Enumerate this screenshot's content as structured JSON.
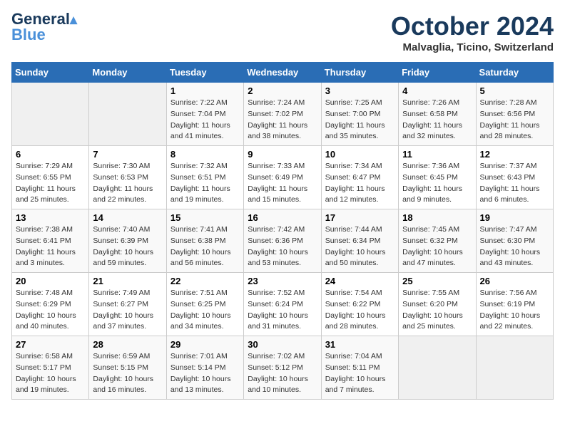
{
  "header": {
    "logo_line1": "General",
    "logo_line2": "Blue",
    "month": "October 2024",
    "location": "Malvaglia, Ticino, Switzerland"
  },
  "days_of_week": [
    "Sunday",
    "Monday",
    "Tuesday",
    "Wednesday",
    "Thursday",
    "Friday",
    "Saturday"
  ],
  "weeks": [
    [
      {
        "day": "",
        "sunrise": "",
        "sunset": "",
        "daylight": ""
      },
      {
        "day": "",
        "sunrise": "",
        "sunset": "",
        "daylight": ""
      },
      {
        "day": "1",
        "sunrise": "Sunrise: 7:22 AM",
        "sunset": "Sunset: 7:04 PM",
        "daylight": "Daylight: 11 hours and 41 minutes."
      },
      {
        "day": "2",
        "sunrise": "Sunrise: 7:24 AM",
        "sunset": "Sunset: 7:02 PM",
        "daylight": "Daylight: 11 hours and 38 minutes."
      },
      {
        "day": "3",
        "sunrise": "Sunrise: 7:25 AM",
        "sunset": "Sunset: 7:00 PM",
        "daylight": "Daylight: 11 hours and 35 minutes."
      },
      {
        "day": "4",
        "sunrise": "Sunrise: 7:26 AM",
        "sunset": "Sunset: 6:58 PM",
        "daylight": "Daylight: 11 hours and 32 minutes."
      },
      {
        "day": "5",
        "sunrise": "Sunrise: 7:28 AM",
        "sunset": "Sunset: 6:56 PM",
        "daylight": "Daylight: 11 hours and 28 minutes."
      }
    ],
    [
      {
        "day": "6",
        "sunrise": "Sunrise: 7:29 AM",
        "sunset": "Sunset: 6:55 PM",
        "daylight": "Daylight: 11 hours and 25 minutes."
      },
      {
        "day": "7",
        "sunrise": "Sunrise: 7:30 AM",
        "sunset": "Sunset: 6:53 PM",
        "daylight": "Daylight: 11 hours and 22 minutes."
      },
      {
        "day": "8",
        "sunrise": "Sunrise: 7:32 AM",
        "sunset": "Sunset: 6:51 PM",
        "daylight": "Daylight: 11 hours and 19 minutes."
      },
      {
        "day": "9",
        "sunrise": "Sunrise: 7:33 AM",
        "sunset": "Sunset: 6:49 PM",
        "daylight": "Daylight: 11 hours and 15 minutes."
      },
      {
        "day": "10",
        "sunrise": "Sunrise: 7:34 AM",
        "sunset": "Sunset: 6:47 PM",
        "daylight": "Daylight: 11 hours and 12 minutes."
      },
      {
        "day": "11",
        "sunrise": "Sunrise: 7:36 AM",
        "sunset": "Sunset: 6:45 PM",
        "daylight": "Daylight: 11 hours and 9 minutes."
      },
      {
        "day": "12",
        "sunrise": "Sunrise: 7:37 AM",
        "sunset": "Sunset: 6:43 PM",
        "daylight": "Daylight: 11 hours and 6 minutes."
      }
    ],
    [
      {
        "day": "13",
        "sunrise": "Sunrise: 7:38 AM",
        "sunset": "Sunset: 6:41 PM",
        "daylight": "Daylight: 11 hours and 3 minutes."
      },
      {
        "day": "14",
        "sunrise": "Sunrise: 7:40 AM",
        "sunset": "Sunset: 6:39 PM",
        "daylight": "Daylight: 10 hours and 59 minutes."
      },
      {
        "day": "15",
        "sunrise": "Sunrise: 7:41 AM",
        "sunset": "Sunset: 6:38 PM",
        "daylight": "Daylight: 10 hours and 56 minutes."
      },
      {
        "day": "16",
        "sunrise": "Sunrise: 7:42 AM",
        "sunset": "Sunset: 6:36 PM",
        "daylight": "Daylight: 10 hours and 53 minutes."
      },
      {
        "day": "17",
        "sunrise": "Sunrise: 7:44 AM",
        "sunset": "Sunset: 6:34 PM",
        "daylight": "Daylight: 10 hours and 50 minutes."
      },
      {
        "day": "18",
        "sunrise": "Sunrise: 7:45 AM",
        "sunset": "Sunset: 6:32 PM",
        "daylight": "Daylight: 10 hours and 47 minutes."
      },
      {
        "day": "19",
        "sunrise": "Sunrise: 7:47 AM",
        "sunset": "Sunset: 6:30 PM",
        "daylight": "Daylight: 10 hours and 43 minutes."
      }
    ],
    [
      {
        "day": "20",
        "sunrise": "Sunrise: 7:48 AM",
        "sunset": "Sunset: 6:29 PM",
        "daylight": "Daylight: 10 hours and 40 minutes."
      },
      {
        "day": "21",
        "sunrise": "Sunrise: 7:49 AM",
        "sunset": "Sunset: 6:27 PM",
        "daylight": "Daylight: 10 hours and 37 minutes."
      },
      {
        "day": "22",
        "sunrise": "Sunrise: 7:51 AM",
        "sunset": "Sunset: 6:25 PM",
        "daylight": "Daylight: 10 hours and 34 minutes."
      },
      {
        "day": "23",
        "sunrise": "Sunrise: 7:52 AM",
        "sunset": "Sunset: 6:24 PM",
        "daylight": "Daylight: 10 hours and 31 minutes."
      },
      {
        "day": "24",
        "sunrise": "Sunrise: 7:54 AM",
        "sunset": "Sunset: 6:22 PM",
        "daylight": "Daylight: 10 hours and 28 minutes."
      },
      {
        "day": "25",
        "sunrise": "Sunrise: 7:55 AM",
        "sunset": "Sunset: 6:20 PM",
        "daylight": "Daylight: 10 hours and 25 minutes."
      },
      {
        "day": "26",
        "sunrise": "Sunrise: 7:56 AM",
        "sunset": "Sunset: 6:19 PM",
        "daylight": "Daylight: 10 hours and 22 minutes."
      }
    ],
    [
      {
        "day": "27",
        "sunrise": "Sunrise: 6:58 AM",
        "sunset": "Sunset: 5:17 PM",
        "daylight": "Daylight: 10 hours and 19 minutes."
      },
      {
        "day": "28",
        "sunrise": "Sunrise: 6:59 AM",
        "sunset": "Sunset: 5:15 PM",
        "daylight": "Daylight: 10 hours and 16 minutes."
      },
      {
        "day": "29",
        "sunrise": "Sunrise: 7:01 AM",
        "sunset": "Sunset: 5:14 PM",
        "daylight": "Daylight: 10 hours and 13 minutes."
      },
      {
        "day": "30",
        "sunrise": "Sunrise: 7:02 AM",
        "sunset": "Sunset: 5:12 PM",
        "daylight": "Daylight: 10 hours and 10 minutes."
      },
      {
        "day": "31",
        "sunrise": "Sunrise: 7:04 AM",
        "sunset": "Sunset: 5:11 PM",
        "daylight": "Daylight: 10 hours and 7 minutes."
      },
      {
        "day": "",
        "sunrise": "",
        "sunset": "",
        "daylight": ""
      },
      {
        "day": "",
        "sunrise": "",
        "sunset": "",
        "daylight": ""
      }
    ]
  ]
}
